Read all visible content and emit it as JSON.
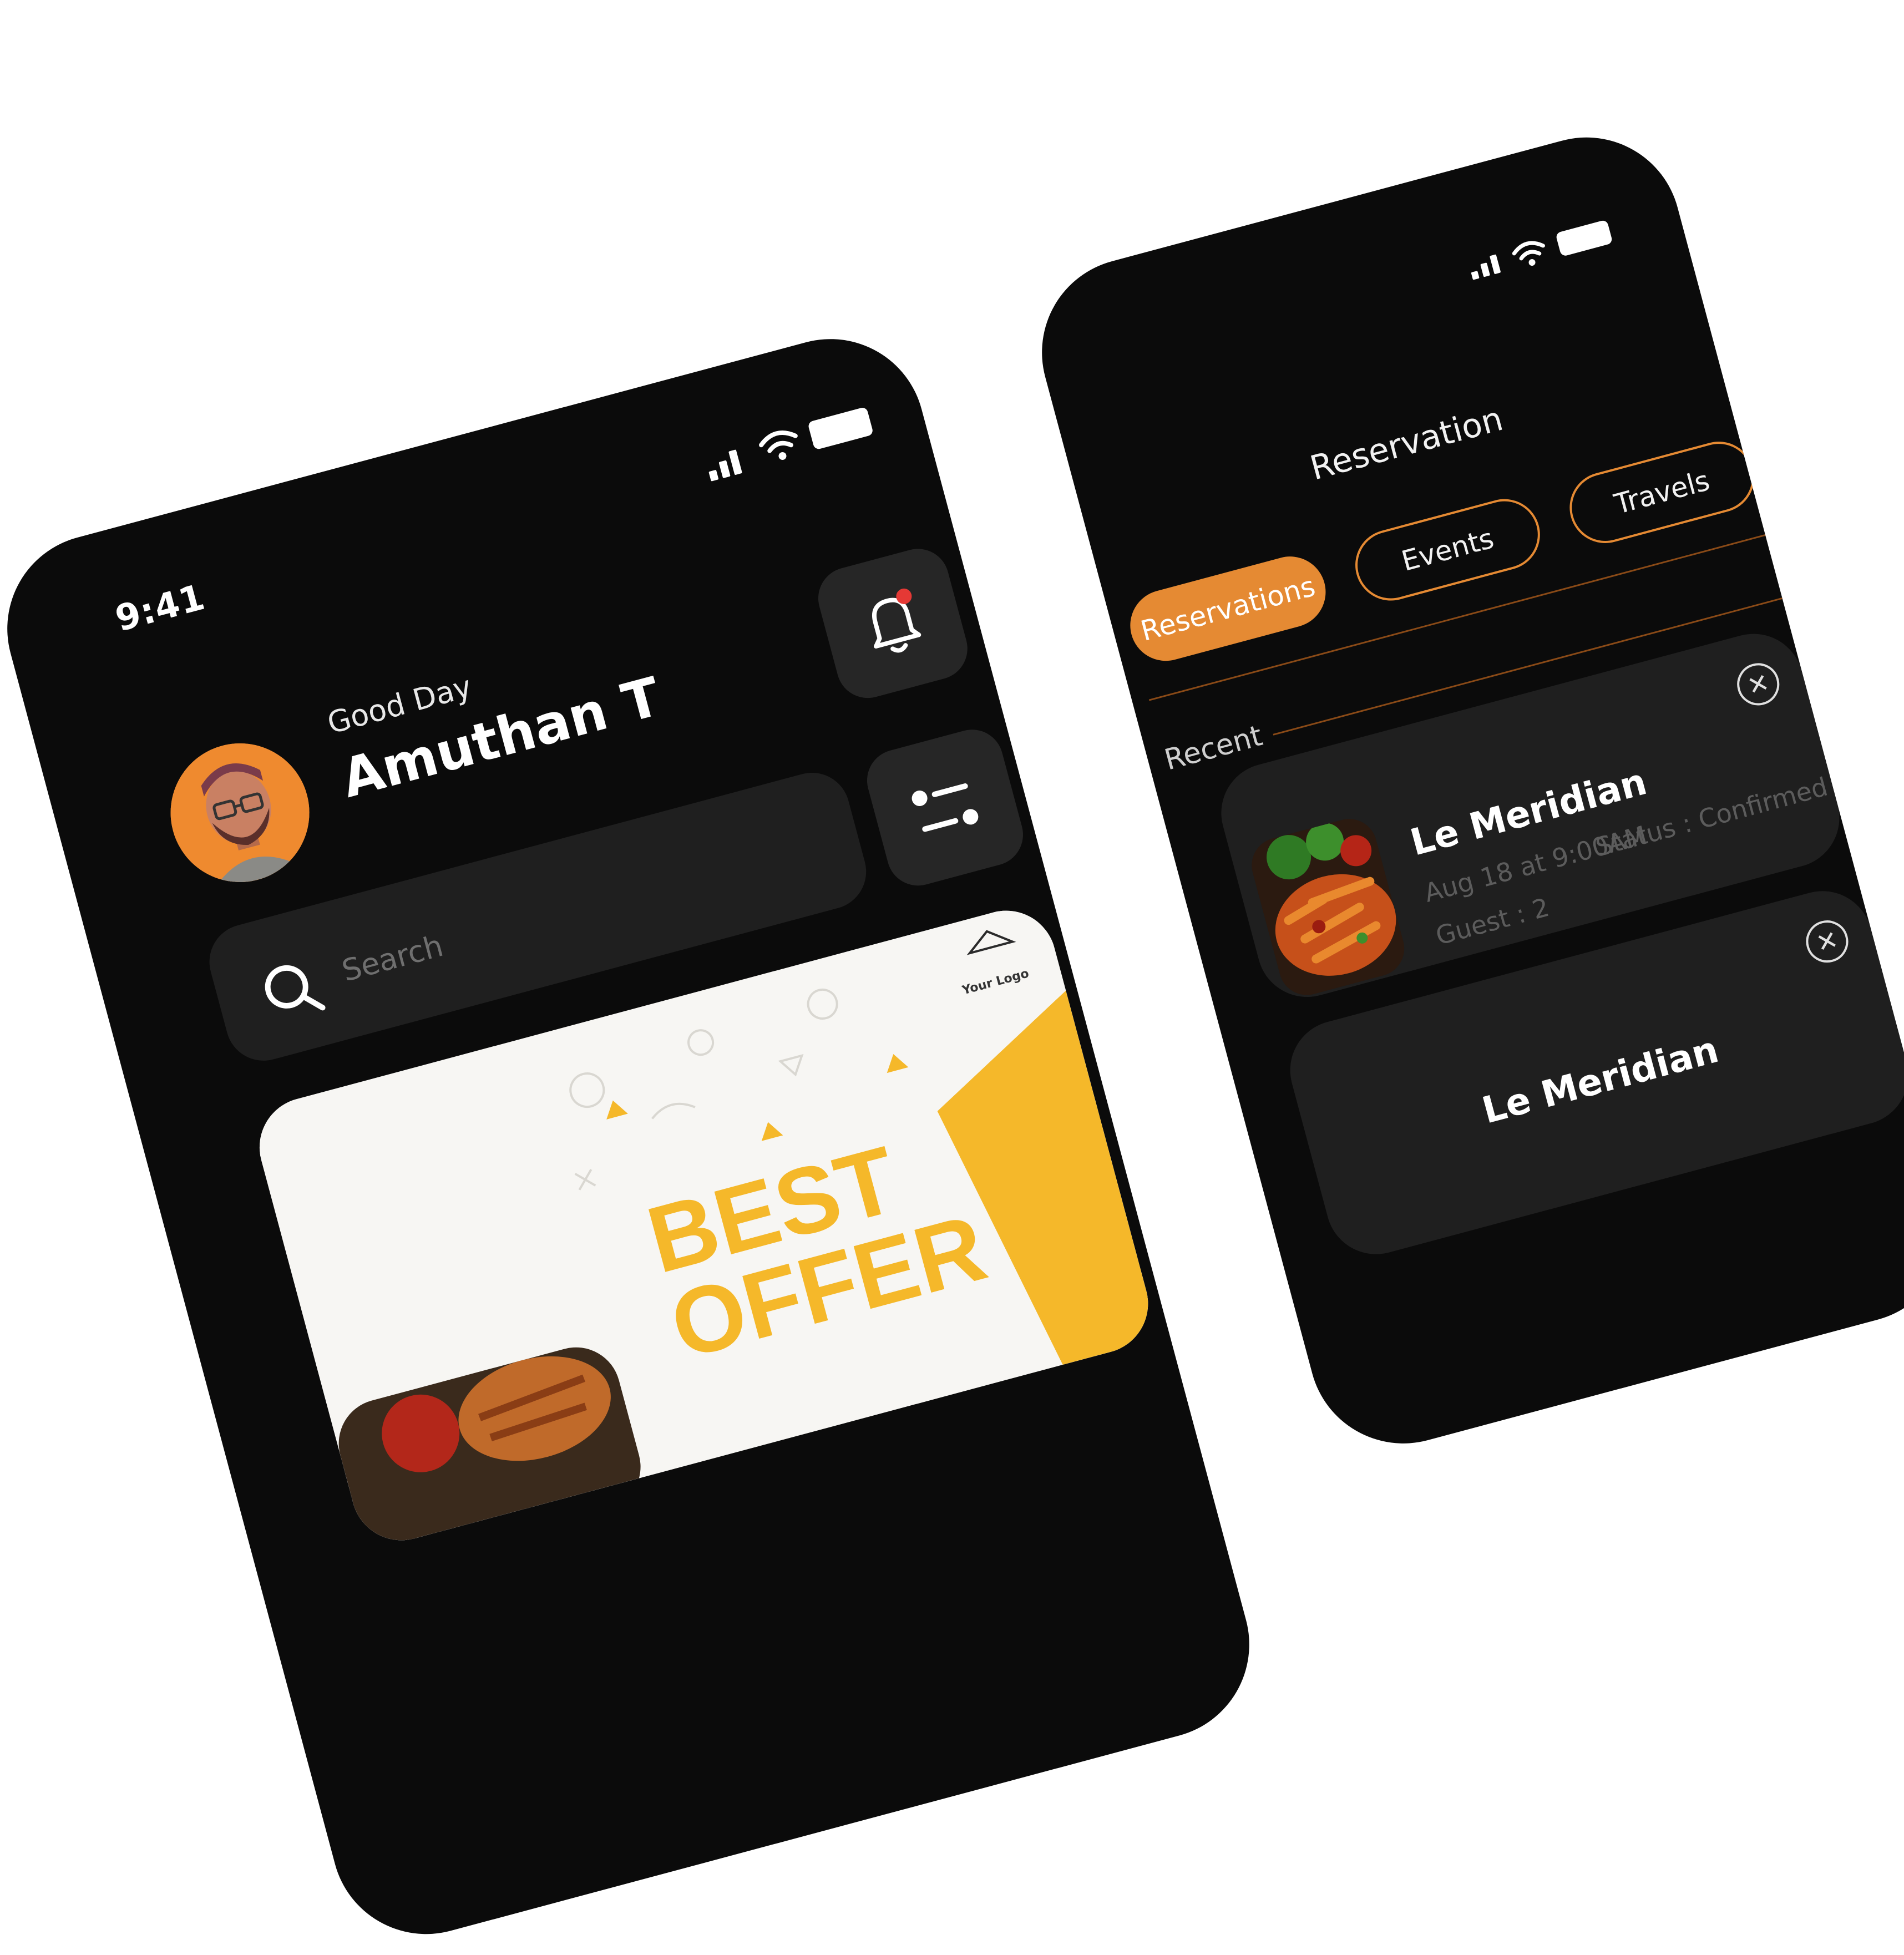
{
  "front": {
    "status": {
      "time": "9:41"
    },
    "header": {
      "greeting": "Good Day",
      "user_name": "Amuthan T"
    },
    "search": {
      "placeholder": "Search"
    },
    "icons": {
      "notification": "bell-icon",
      "filter": "filter-icon",
      "search": "search-icon",
      "avatar": "avatar"
    },
    "banner": {
      "headline_1": "BEST",
      "headline_2": "OFFER",
      "logo_text": "Your Logo"
    }
  },
  "back": {
    "title": "Reservation",
    "tabs": [
      {
        "label": "Reservations",
        "active": true
      },
      {
        "label": "Events",
        "active": false
      },
      {
        "label": "Travels",
        "active": false
      }
    ],
    "section_label": "Recent",
    "cards": [
      {
        "title": "Le Meridian",
        "date": "Aug 18 at 9:00AM",
        "guests": "Guest : 2",
        "status": "Status : Confirmed"
      },
      {
        "title": "Le Meridian"
      }
    ]
  },
  "colors": {
    "accent": "#e58a33",
    "phone_bg": "#0b0b0b",
    "card_bg": "#1f1f1f",
    "notification_dot": "#e53935",
    "banner_yellow": "#f5b82a"
  }
}
